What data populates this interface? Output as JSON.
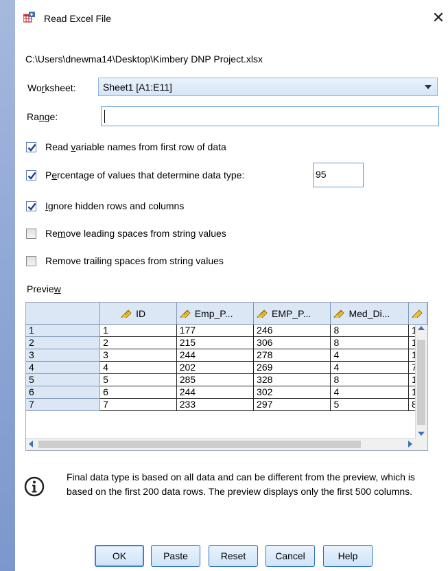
{
  "window": {
    "title": "Read Excel File",
    "close_glyph": "✕"
  },
  "file_path": "C:\\Users\\dnewma14\\Desktop\\Kimbery DNP Project.xlsx",
  "worksheet": {
    "label_pre": "Wo",
    "label_key": "r",
    "label_post": "ksheet:",
    "value": "Sheet1 [A1:E11]"
  },
  "range": {
    "label_pre": "Ra",
    "label_key": "n",
    "label_post": "ge:",
    "value": ""
  },
  "options": {
    "read_names": {
      "pre": "Read ",
      "key": "v",
      "post": "ariable names from first row of data",
      "checked": true
    },
    "percentage": {
      "pre": "P",
      "key": "e",
      "post": "rcentage of values that determine data type:",
      "checked": true,
      "value": "95"
    },
    "ignore_hidden": {
      "pre": "",
      "key": "I",
      "post": "gnore hidden rows and columns",
      "checked": true
    },
    "remove_leading": {
      "pre": "Re",
      "key": "m",
      "post": "ove leading spaces from string values",
      "checked": false
    },
    "remove_trailing": {
      "pre": "Remove trailin",
      "key": "g",
      "post": " spaces from string values",
      "checked": false
    }
  },
  "preview": {
    "label_pre": "Previe",
    "label_key": "w",
    "columns": [
      "ID",
      "Emp_P...",
      "EMP_P...",
      "Med_Di..."
    ],
    "rows": [
      [
        "1",
        "1",
        "177",
        "246",
        "8",
        "1"
      ],
      [
        "2",
        "2",
        "215",
        "306",
        "8",
        "1"
      ],
      [
        "3",
        "3",
        "244",
        "278",
        "4",
        "1"
      ],
      [
        "4",
        "4",
        "202",
        "269",
        "4",
        "7"
      ],
      [
        "5",
        "5",
        "285",
        "328",
        "8",
        "1"
      ],
      [
        "6",
        "6",
        "244",
        "302",
        "4",
        "1"
      ],
      [
        "7",
        "7",
        "233",
        "297",
        "5",
        "8"
      ]
    ]
  },
  "info": "Final data type is based on all data and can be different from the preview, which is based on the first 200 data rows. The preview displays only the first 500 columns.",
  "buttons": {
    "ok": "OK",
    "paste": "Paste",
    "reset": "Reset",
    "cancel": "Cancel",
    "help": "Help"
  },
  "colors": {
    "accent": "#3d7fd1",
    "check": "#1e3f8a",
    "header_bg": "#dbe7f5"
  },
  "icons": {
    "app": "table-import-icon",
    "info": "info-circle-icon",
    "variable": "ruler-icon"
  }
}
